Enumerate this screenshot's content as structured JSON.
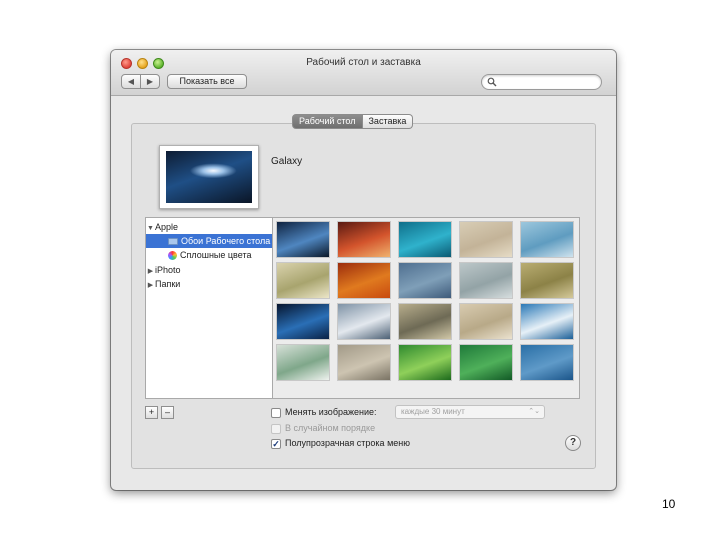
{
  "window": {
    "title": "Рабочий стол и заставка"
  },
  "toolbar": {
    "back_icon": "◀",
    "forward_icon": "▶",
    "show_all_label": "Показать все",
    "search_placeholder": ""
  },
  "tabs": [
    {
      "label": "Рабочий стол",
      "selected": true
    },
    {
      "label": "Заставка",
      "selected": false
    }
  ],
  "current_wallpaper": {
    "name": "Galaxy"
  },
  "sources": [
    {
      "label": "Apple",
      "disclosure": "▼",
      "icon": "none",
      "selected": false
    },
    {
      "label": "Обои Рабочего стола",
      "disclosure": "",
      "icon": "folder-icon",
      "selected": true
    },
    {
      "label": "Сплошные цвета",
      "disclosure": "",
      "icon": "colors-icon",
      "selected": false
    },
    {
      "label": "iPhoto",
      "disclosure": "▶",
      "icon": "none",
      "selected": false
    },
    {
      "label": "Папки",
      "disclosure": "▶",
      "icon": "none",
      "selected": false
    }
  ],
  "thumbnails": [
    {
      "name": "galaxy",
      "colors": [
        "#0f2340",
        "#4f86c0",
        "#0b1829"
      ]
    },
    {
      "name": "red-rock",
      "colors": [
        "#5a1a12",
        "#d3542c",
        "#f0b26e"
      ]
    },
    {
      "name": "ocean-waves",
      "colors": [
        "#0f6f8a",
        "#2fb2cc",
        "#0b5a73"
      ]
    },
    {
      "name": "sand-dunes",
      "colors": [
        "#d8cdb5",
        "#c3b398",
        "#e6dcc6"
      ]
    },
    {
      "name": "blue-trees",
      "colors": [
        "#9cc7dd",
        "#5f9cc0",
        "#cfe3ee"
      ]
    },
    {
      "name": "grass",
      "colors": [
        "#d9d2ad",
        "#a8a46e",
        "#ece6c8"
      ]
    },
    {
      "name": "autumn-leaves",
      "colors": [
        "#9c2d0c",
        "#e07a1f",
        "#c84a0f"
      ]
    },
    {
      "name": "blue-haze",
      "colors": [
        "#4f6f90",
        "#7f9fb8",
        "#3e5a7a"
      ]
    },
    {
      "name": "foggy-lake",
      "colors": [
        "#bcc7c9",
        "#93a3a6",
        "#d7dedf"
      ]
    },
    {
      "name": "savanna-field",
      "colors": [
        "#b9ad72",
        "#8c8247",
        "#d4c99a"
      ]
    },
    {
      "name": "earth-horizon",
      "colors": [
        "#06152e",
        "#2a6fb6",
        "#0a2144"
      ]
    },
    {
      "name": "snow-valley",
      "colors": [
        "#7f93a6",
        "#e3e8ee",
        "#4c6074"
      ]
    },
    {
      "name": "elephant",
      "colors": [
        "#b7ad8c",
        "#6e6a55",
        "#d0c7a7"
      ]
    },
    {
      "name": "desert-herd",
      "colors": [
        "#d8cbb0",
        "#b8a988",
        "#ebe2cf"
      ]
    },
    {
      "name": "ice-field",
      "colors": [
        "#2a78b6",
        "#e6f0f7",
        "#1b5f98"
      ]
    },
    {
      "name": "lily-pads",
      "colors": [
        "#d6e0d8",
        "#7fa78a",
        "#eef2ee"
      ]
    },
    {
      "name": "stone-layers",
      "colors": [
        "#a29a88",
        "#cdc4b1",
        "#7a7364"
      ]
    },
    {
      "name": "frog-leaf",
      "colors": [
        "#2f8a2f",
        "#8fd05a",
        "#1c6a1c"
      ]
    },
    {
      "name": "green-grass",
      "colors": [
        "#1f7a3a",
        "#4fb05a",
        "#125a26"
      ]
    },
    {
      "name": "blue-water",
      "colors": [
        "#2a6fa6",
        "#5f9ac8",
        "#1b558a"
      ]
    },
    {
      "name": "peach-dunes",
      "colors": [
        "#e8c7a0",
        "#d5a47a",
        "#f3dcbf"
      ]
    },
    {
      "name": "purple-flower",
      "colors": [
        "#6a3a88",
        "#b07ad0",
        "#3f2058"
      ]
    },
    {
      "name": "orange-sky",
      "colors": [
        "#e88a2a",
        "#f5c060",
        "#c46a18"
      ]
    },
    {
      "name": "teal-sea",
      "colors": [
        "#2a8aa0",
        "#7fc6d0",
        "#1b6a80"
      ]
    },
    {
      "name": "grey-mist",
      "colors": [
        "#9aa3ab",
        "#c7ced4",
        "#7f8890"
      ]
    }
  ],
  "bottom_controls": {
    "add_label": "+",
    "remove_label": "–"
  },
  "options": {
    "change_picture": {
      "label": "Менять изображение:",
      "checked": false
    },
    "interval": {
      "value": "каждые 30 минут",
      "arrow": "⌃⌄"
    },
    "random_order": {
      "label": "В случайном порядке",
      "checked": false,
      "disabled": true
    },
    "translucent_menu": {
      "label": "Полупрозрачная строка меню",
      "checked": true,
      "check_glyph": "✓"
    }
  },
  "help": {
    "label": "?"
  },
  "page_number": "10"
}
